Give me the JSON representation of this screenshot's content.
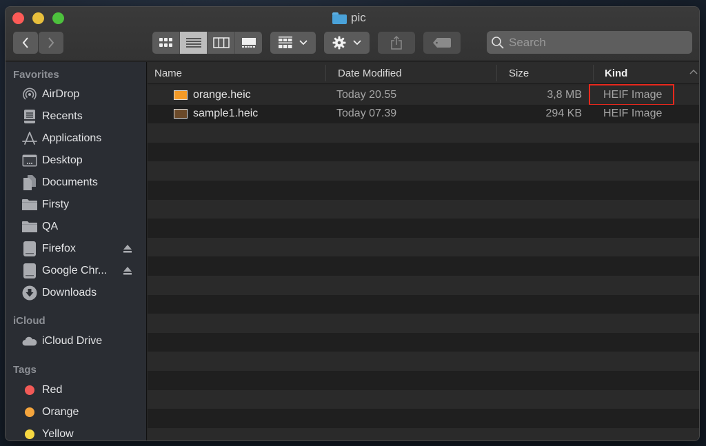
{
  "window": {
    "title": "pic",
    "title_icon": "folder-icon"
  },
  "toolbar": {
    "back": "back-chevron-icon",
    "forward": "forward-chevron-icon",
    "view_modes": [
      {
        "name": "icon-view",
        "icon": "grid-icon",
        "active": false
      },
      {
        "name": "list-view",
        "icon": "list-icon",
        "active": true
      },
      {
        "name": "column-view",
        "icon": "columns-icon",
        "active": false
      },
      {
        "name": "gallery-view",
        "icon": "gallery-icon",
        "active": false
      }
    ],
    "arrange": "group-by-icon",
    "action": "gear-icon",
    "share": "share-icon",
    "tags": "tag-icon",
    "search_placeholder": "Search",
    "search_value": ""
  },
  "sidebar": {
    "favorites_label": "Favorites",
    "favorites": [
      {
        "label": "AirDrop",
        "icon": "airdrop-icon"
      },
      {
        "label": "Recents",
        "icon": "recents-icon"
      },
      {
        "label": "Applications",
        "icon": "applications-icon"
      },
      {
        "label": "Desktop",
        "icon": "desktop-icon"
      },
      {
        "label": "Documents",
        "icon": "documents-icon"
      },
      {
        "label": "Firsty",
        "icon": "folder-icon"
      },
      {
        "label": "QA",
        "icon": "folder-icon"
      },
      {
        "label": "Firefox",
        "icon": "drive-icon",
        "ejectable": true
      },
      {
        "label": "Google Chr...",
        "icon": "drive-icon",
        "ejectable": true
      },
      {
        "label": "Downloads",
        "icon": "downloads-icon"
      }
    ],
    "icloud_label": "iCloud",
    "icloud": [
      {
        "label": "iCloud Drive",
        "icon": "cloud-icon"
      }
    ],
    "tags_label": "Tags",
    "tags": [
      {
        "label": "Red",
        "color": "#f25a57"
      },
      {
        "label": "Orange",
        "color": "#f5a53d"
      },
      {
        "label": "Yellow",
        "color": "#f7d842"
      }
    ]
  },
  "list": {
    "columns": {
      "name": "Name",
      "date": "Date Modified",
      "size": "Size",
      "kind": "Kind"
    },
    "sort_column": "Kind",
    "files": [
      {
        "name": "orange.heic",
        "date": "Today 20.55",
        "size": "3,8 MB",
        "kind": "HEIF Image",
        "thumb_color": "#f39a27",
        "highlighted": true
      },
      {
        "name": "sample1.heic",
        "date": "Today 07.39",
        "size": "294 KB",
        "kind": "HEIF Image",
        "thumb_color": "#6b4a2a",
        "highlighted": false
      }
    ],
    "highlight_color": "#e8281c"
  }
}
